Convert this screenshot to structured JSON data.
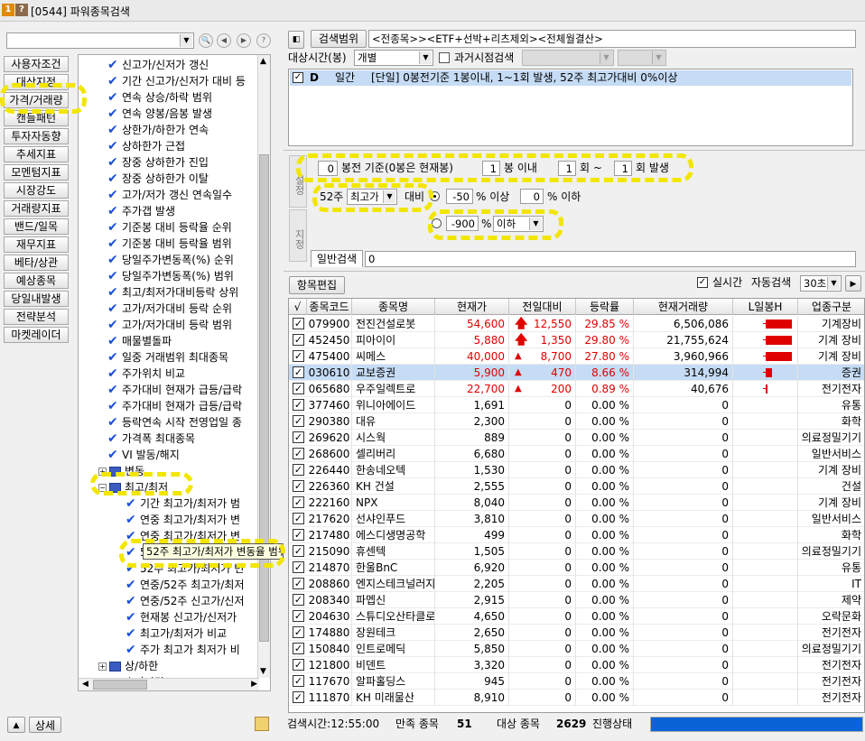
{
  "title": {
    "icon1": "1",
    "icon2": "?",
    "text": "[0544] 파워종목검색"
  },
  "left": {
    "combo_value": "",
    "categories": [
      "사용자조건",
      "대상지정",
      "가격/거래량",
      "캔들패턴",
      "투자자동향",
      "추세지표",
      "모멘텀지표",
      "시장강도",
      "거래량지표",
      "밴드/일목",
      "재무지표",
      "베타/상관",
      "예상종목",
      "당일내발생",
      "전략분석",
      "마켓레이더"
    ],
    "detail_label": "상세"
  },
  "tree": {
    "items": [
      {
        "text": "신고가/신저가 갱신",
        "type": "check",
        "indent": 1
      },
      {
        "text": "기간 신고가/신저가 대비 등",
        "type": "check",
        "indent": 1
      },
      {
        "text": "연속 상승/하락 범위",
        "type": "check",
        "indent": 1
      },
      {
        "text": "연속 양봉/음봉 발생",
        "type": "check",
        "indent": 1
      },
      {
        "text": "상한가/하한가 연속",
        "type": "check",
        "indent": 1
      },
      {
        "text": "상하한가 근접",
        "type": "check",
        "indent": 1
      },
      {
        "text": "장중 상하한가 진입",
        "type": "check",
        "indent": 1
      },
      {
        "text": "장중 상하한가 이탈",
        "type": "check",
        "indent": 1
      },
      {
        "text": "고가/저가 갱신 연속일수",
        "type": "check",
        "indent": 1
      },
      {
        "text": "주가갭 발생",
        "type": "check",
        "indent": 1
      },
      {
        "text": "기준봉 대비 등락율 순위",
        "type": "check",
        "indent": 1
      },
      {
        "text": "기준봉 대비 등락율 범위",
        "type": "check",
        "indent": 1
      },
      {
        "text": "당일주가변동폭(%) 순위",
        "type": "check",
        "indent": 1
      },
      {
        "text": "당일주가변동폭(%) 범위",
        "type": "check",
        "indent": 1
      },
      {
        "text": "최고/최저가대비등락 상위",
        "type": "check",
        "indent": 1
      },
      {
        "text": "고가/저가대비 등락 순위",
        "type": "check",
        "indent": 1
      },
      {
        "text": "고가/저가대비 등락 범위",
        "type": "check",
        "indent": 1
      },
      {
        "text": "매물별돌파",
        "type": "check",
        "indent": 1
      },
      {
        "text": "일중 거래범위 최대종목",
        "type": "check",
        "indent": 1
      },
      {
        "text": "주가위치 비교",
        "type": "check",
        "indent": 1
      },
      {
        "text": "주가대비 현재가 급등/급락",
        "type": "check",
        "indent": 1
      },
      {
        "text": "주가대비 현재가 급등/급락",
        "type": "check",
        "indent": 1
      },
      {
        "text": "등락연속 시작 전영업일 종",
        "type": "check",
        "indent": 1
      },
      {
        "text": "가격폭 최대종목",
        "type": "check",
        "indent": 1
      },
      {
        "text": "VI 발동/해지",
        "type": "check",
        "indent": 1
      },
      {
        "text": "변동",
        "type": "folder",
        "toggle": "+",
        "indent": 0
      },
      {
        "text": "최고/최저",
        "type": "folder",
        "toggle": "−",
        "indent": 0
      },
      {
        "text": "기간 최고가/최저가 범",
        "type": "check",
        "indent": 2
      },
      {
        "text": "연중 최고가/최저가 변",
        "type": "check",
        "indent": 2
      },
      {
        "text": "연중 최고가/최저가 변",
        "type": "check",
        "indent": 2
      },
      {
        "text": "52주 최고가/최저가 변동율 범위",
        "type": "check",
        "indent": 2,
        "tooltip": true
      },
      {
        "text": "52주 최고가/최저가 변",
        "type": "check",
        "indent": 2
      },
      {
        "text": "연중/52주 최고가/최저",
        "type": "check",
        "indent": 2
      },
      {
        "text": "연중/52주 신고가/신저",
        "type": "check",
        "indent": 2
      },
      {
        "text": "현재봉 신고가/신저가",
        "type": "check",
        "indent": 2
      },
      {
        "text": "최고가/최저가 비교",
        "type": "check",
        "indent": 2
      },
      {
        "text": "주가 최고가 최저가 비",
        "type": "check",
        "indent": 2
      },
      {
        "text": "상/하한",
        "type": "folder",
        "toggle": "+",
        "indent": 0
      },
      {
        "text": "호가잔량",
        "type": "folder",
        "toggle": "+",
        "indent": 0
      }
    ]
  },
  "search": {
    "scope_btn": "검색범위",
    "scope_text": "<전종목>><ETF+선박+리츠제외><전체월결산>",
    "target_time_label": "대상시간(봉)",
    "target_time_value": "개별",
    "past_search_label": "과거시점검색",
    "condition": {
      "check": "✓",
      "letter": "D",
      "period": "일간",
      "desc": "[단일] 0봉전기준 1봉이내, 1~1회 발생, 52주 최고가대비 0%이상"
    }
  },
  "settings": {
    "side_top": "설정",
    "side_bottom": "지정",
    "bong_value": "0",
    "bong_label": "봉전 기준(0봉은 현재봉)",
    "within_value": "1",
    "within_label": "봉 이내",
    "count_from": "1",
    "count_from_label": "회 ~",
    "count_to": "1",
    "count_to_label": "회 발생",
    "week52_label": "52주",
    "week52_select": "최고가",
    "vs_label": "대비",
    "pct_min": "-50",
    "pct_min_label": "% 이상",
    "pct_max": "0",
    "pct_max_label": "% 이하",
    "pct2": "-900",
    "pct2_label": "%",
    "pct2_select": "이하",
    "general_search": "일반검색",
    "general_value": "0"
  },
  "grid_toolbar": {
    "edit_btn": "항목편집",
    "realtime_label": "실시간",
    "auto_label": "자동검색",
    "interval": "30초"
  },
  "grid": {
    "headers": [
      "√",
      "종목코드",
      "종목명",
      "현재가",
      "전일대비",
      "등락률",
      "현재거래량",
      "L일봉H",
      "업종구분"
    ],
    "rows": [
      {
        "code": "079900",
        "name": "전진건설로봇",
        "price": "54,600",
        "arrow": "up",
        "diff": "12,550",
        "rate": "29.85 %",
        "vol": "6,506,086",
        "bar": 0.85,
        "sector": "기계장비",
        "hl": false
      },
      {
        "code": "452450",
        "name": "피아이이",
        "price": "5,880",
        "arrow": "up",
        "diff": "1,350",
        "rate": "29.80 %",
        "vol": "21,755,624",
        "bar": 0.85,
        "sector": "기계 장비",
        "hl": false
      },
      {
        "code": "475400",
        "name": "씨메스",
        "price": "40,000",
        "arrow": "tri",
        "diff": "8,700",
        "rate": "27.80 %",
        "vol": "3,960,966",
        "bar": 0.85,
        "sector": "기계 장비",
        "hl": false
      },
      {
        "code": "030610",
        "name": "교보증권",
        "price": "5,900",
        "arrow": "tri",
        "diff": "470",
        "rate": "8.66 %",
        "vol": "314,994",
        "bar": 0.2,
        "sector": "증권",
        "hl": true
      },
      {
        "code": "065680",
        "name": "우주일렉트로",
        "price": "22,700",
        "arrow": "tri",
        "diff": "200",
        "rate": "0.89 %",
        "vol": "40,676",
        "bar": 0.05,
        "sector": "전기전자",
        "hl": false
      },
      {
        "code": "377460",
        "name": "위니아에이드",
        "price": "1,691",
        "arrow": "",
        "diff": "0",
        "rate": "0.00 %",
        "vol": "0",
        "bar": 0,
        "sector": "유통",
        "hl": false
      },
      {
        "code": "290380",
        "name": "대유",
        "price": "2,300",
        "arrow": "",
        "diff": "0",
        "rate": "0.00 %",
        "vol": "0",
        "bar": 0,
        "sector": "화학",
        "hl": false
      },
      {
        "code": "269620",
        "name": "시스웍",
        "price": "889",
        "arrow": "",
        "diff": "0",
        "rate": "0.00 %",
        "vol": "0",
        "bar": 0,
        "sector": "의료정밀기기",
        "hl": false
      },
      {
        "code": "268600",
        "name": "셀리버리",
        "price": "6,680",
        "arrow": "",
        "diff": "0",
        "rate": "0.00 %",
        "vol": "0",
        "bar": 0,
        "sector": "일반서비스",
        "hl": false
      },
      {
        "code": "226440",
        "name": "한송네오텍",
        "price": "1,530",
        "arrow": "",
        "diff": "0",
        "rate": "0.00 %",
        "vol": "0",
        "bar": 0,
        "sector": "기계 장비",
        "hl": false
      },
      {
        "code": "226360",
        "name": "KH 건설",
        "price": "2,555",
        "arrow": "",
        "diff": "0",
        "rate": "0.00 %",
        "vol": "0",
        "bar": 0,
        "sector": "건설",
        "hl": false
      },
      {
        "code": "222160",
        "name": "NPX",
        "price": "8,040",
        "arrow": "",
        "diff": "0",
        "rate": "0.00 %",
        "vol": "0",
        "bar": 0,
        "sector": "기계 장비",
        "hl": false
      },
      {
        "code": "217620",
        "name": "선샤인푸드",
        "price": "3,810",
        "arrow": "",
        "diff": "0",
        "rate": "0.00 %",
        "vol": "0",
        "bar": 0,
        "sector": "일반서비스",
        "hl": false
      },
      {
        "code": "217480",
        "name": "에스디생명공학",
        "price": "499",
        "arrow": "",
        "diff": "0",
        "rate": "0.00 %",
        "vol": "0",
        "bar": 0,
        "sector": "화학",
        "hl": false
      },
      {
        "code": "215090",
        "name": "휴센텍",
        "price": "1,505",
        "arrow": "",
        "diff": "0",
        "rate": "0.00 %",
        "vol": "0",
        "bar": 0,
        "sector": "의료정밀기기",
        "hl": false
      },
      {
        "code": "214870",
        "name": "한울BnC",
        "price": "6,920",
        "arrow": "",
        "diff": "0",
        "rate": "0.00 %",
        "vol": "0",
        "bar": 0,
        "sector": "유통",
        "hl": false
      },
      {
        "code": "208860",
        "name": "엔지스테크널러지",
        "price": "2,205",
        "arrow": "",
        "diff": "0",
        "rate": "0.00 %",
        "vol": "0",
        "bar": 0,
        "sector": "IT",
        "hl": false
      },
      {
        "code": "208340",
        "name": "파멥신",
        "price": "2,915",
        "arrow": "",
        "diff": "0",
        "rate": "0.00 %",
        "vol": "0",
        "bar": 0,
        "sector": "제약",
        "hl": false
      },
      {
        "code": "204630",
        "name": "스튜디오산타클로",
        "price": "4,650",
        "arrow": "",
        "diff": "0",
        "rate": "0.00 %",
        "vol": "0",
        "bar": 0,
        "sector": "오락문화",
        "hl": false
      },
      {
        "code": "174880",
        "name": "장원테크",
        "price": "2,650",
        "arrow": "",
        "diff": "0",
        "rate": "0.00 %",
        "vol": "0",
        "bar": 0,
        "sector": "전기전자",
        "hl": false
      },
      {
        "code": "150840",
        "name": "인트로메딕",
        "price": "5,850",
        "arrow": "",
        "diff": "0",
        "rate": "0.00 %",
        "vol": "0",
        "bar": 0,
        "sector": "의료정밀기기",
        "hl": false
      },
      {
        "code": "121800",
        "name": "비덴트",
        "price": "3,320",
        "arrow": "",
        "diff": "0",
        "rate": "0.00 %",
        "vol": "0",
        "bar": 0,
        "sector": "전기전자",
        "hl": false
      },
      {
        "code": "117670",
        "name": "알파홀딩스",
        "price": "945",
        "arrow": "",
        "diff": "0",
        "rate": "0.00 %",
        "vol": "0",
        "bar": 0,
        "sector": "전기전자",
        "hl": false
      },
      {
        "code": "111870",
        "name": "KH 미래물산",
        "price": "8,910",
        "arrow": "",
        "diff": "0",
        "rate": "0.00 %",
        "vol": "0",
        "bar": 0,
        "sector": "전기전자",
        "hl": false
      }
    ]
  },
  "status": {
    "time_label": "검색시간:12:55:00",
    "match_label": "만족 종목",
    "match_count": "51",
    "target_label": "대상 종목",
    "target_count": "2629",
    "progress_label": "진행상태",
    "progress": 1.0
  },
  "colors": {
    "red": "#e00000",
    "highlight": "#c6dcf5",
    "progress": "#0a64d8",
    "annotation": "#f2e600"
  }
}
